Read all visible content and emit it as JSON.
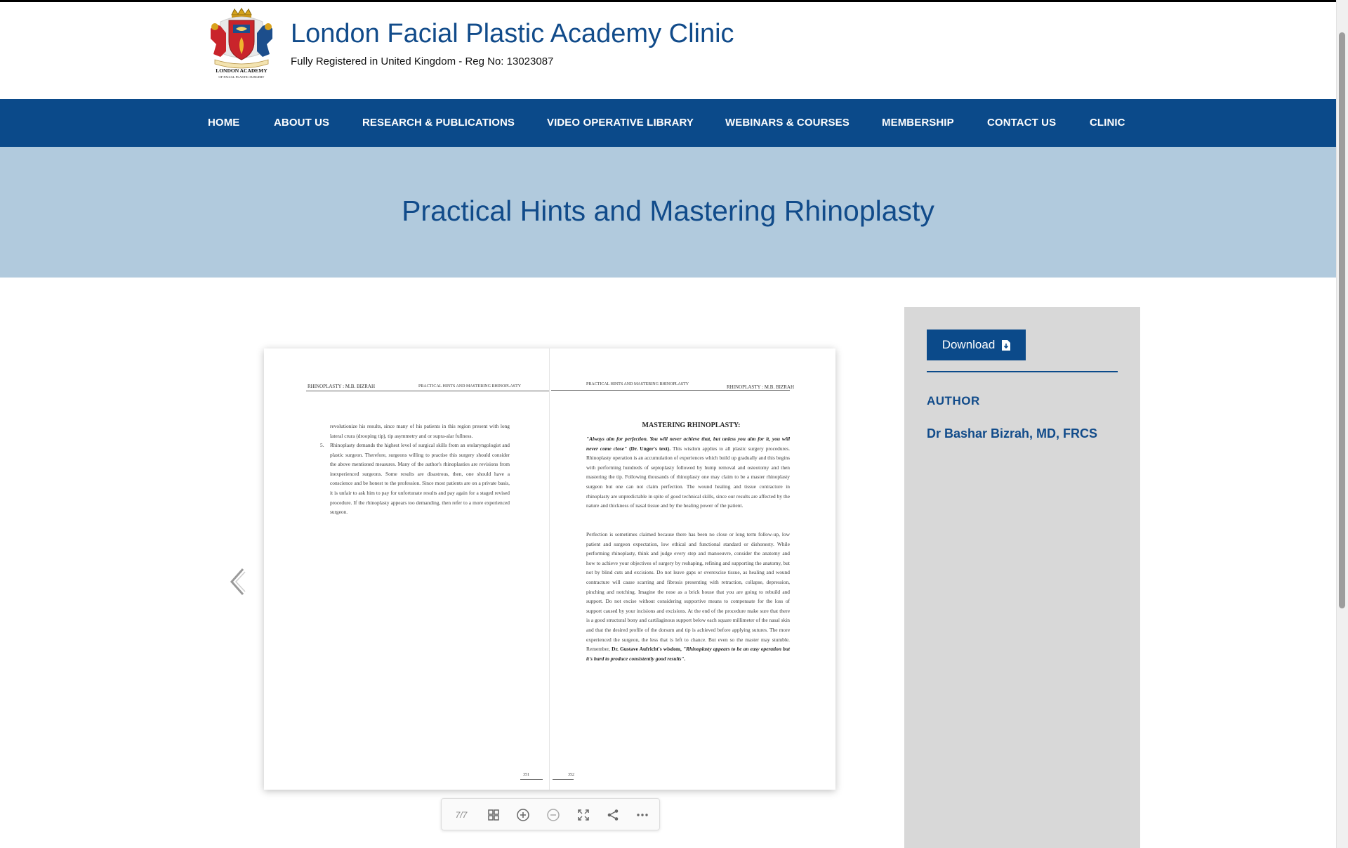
{
  "header": {
    "logo_text": "LONDON ACADEMY OF FACIAL PLASTIC SURGERY",
    "title": "London Facial Plastic Academy Clinic",
    "subtitle": "Fully Registered in United Kingdom - Reg No: 13023087"
  },
  "nav": {
    "items": [
      {
        "label": "HOME"
      },
      {
        "label": "ABOUT US"
      },
      {
        "label": "RESEARCH & PUBLICATIONS"
      },
      {
        "label": "VIDEO OPERATIVE LIBRARY"
      },
      {
        "label": "WEBINARS & COURSES"
      },
      {
        "label": "MEMBERSHIP"
      },
      {
        "label": "CONTACT US"
      },
      {
        "label": "CLINIC"
      }
    ]
  },
  "banner": {
    "title": "Practical Hints and Mastering Rhinoplasty"
  },
  "viewer": {
    "left_page": {
      "running_head_left": "RHINOPLASTY : M.B. BIZRAH",
      "running_head_right": "PRACTICAL HINTS AND MASTERING RHINOPLASTY",
      "text_1": "revolutionize his results, since many of his patients in this region present with long lateral crura (drooping tip), tip asymmetry and or supra-alar fullness.",
      "item_number": "5.",
      "text_2": "Rhinoplasty demands the highest level of surgical skills from an otolaryngologist and plastic surgeon. Therefore, surgeons willing to practise this surgery should consider the above mentioned measures. Many of the author's rhinoplasties are revisions from inexperienced surgeons. Some results are disastrous, then, one should have a conscience and be honest to the profession. Since most patients are on a private basis, it is unfair to ask him to pay for unfortunate results and pay again for a staged revised procedure. If the rhinoplasty appears too demanding, then refer to a more experienced surgeon.",
      "page_number": "351"
    },
    "right_page": {
      "running_head_left": "PRACTICAL HINTS AND MASTERING RHINOPLASTY",
      "running_head_right": "RHINOPLASTY : M.B. BIZRAH",
      "heading": "MASTERING RHINOPLASTY:",
      "quote": "\"Always aim for perfection. You will never achieve that, but unless you aim for it, you will never come close\"",
      "quote_source": "(Dr. Unger's text).",
      "para_1": "This wisdom applies to all plastic surgery procedures. Rhinoplasty operation is an accumulation of experiences which build up gradually and this begins with performing hundreds of septoplasty followed by hump removal and osteotomy and then mastering the tip. Following thousands of rhinoplasty one may claim to be a master rhinoplasty surgeon but one can not claim perfection. The wound healing and tissue contracture in rhinoplasty are unpredictable in spite of good technical skills, since our results are affected by the nature and thickness of nasal tissue and by the healing power of the patient.",
      "para_2": "Perfection is sometimes claimed because there has been no close or long term follow-up, low patient and surgeon expectation, low ethical and functional standard or dishonesty. While performing rhinoplasty, think and judge every step and manoeuvre, consider the anatomy and how to achieve your objectives of surgery by reshaping, refining and supporting the anatomy, but not by blind cuts and excisions. Do not leave gaps or overexcise tissue, as healing and wound contracture will cause scarring and fibrosis presenting with retraction, collapse, depression, pinching and notching. Imagine the nose as a brick house that you are going to rebuild and support. Do not excise without considering supportive means to compensate for the loss of support caused by your incisions and excisions. At the end of the procedure make sure that there is a good structural bony and cartilaginous support below each square millimeter of the nasal skin and that the desired profile of the dorsum and tip is achieved before applying sutures. The more experienced the surgeon, the less that is left to chance. But even so the master may stumble. Remember,",
      "para_2_bold": "Dr. Gustave Aufricht's wisdom,",
      "para_2_quote": "\"Rhinoplasty appears to be an easy operation but it's hard to produce consistently good results\".",
      "page_number": "352"
    },
    "toolbar": {
      "page_count": "7/7",
      "icons": [
        "grid-icon",
        "zoom-in-icon",
        "zoom-out-icon",
        "fullscreen-icon",
        "share-icon",
        "more-icon"
      ]
    }
  },
  "sidebar": {
    "download_label": "Download",
    "author_label": "AUTHOR",
    "author_name": "Dr Bashar Bizrah, MD, FRCS"
  },
  "colors": {
    "brand_blue": "#0b4a8a",
    "title_blue": "#114b8a",
    "banner_bg": "#b1cadd",
    "sidebar_bg": "#d8d8d8"
  }
}
